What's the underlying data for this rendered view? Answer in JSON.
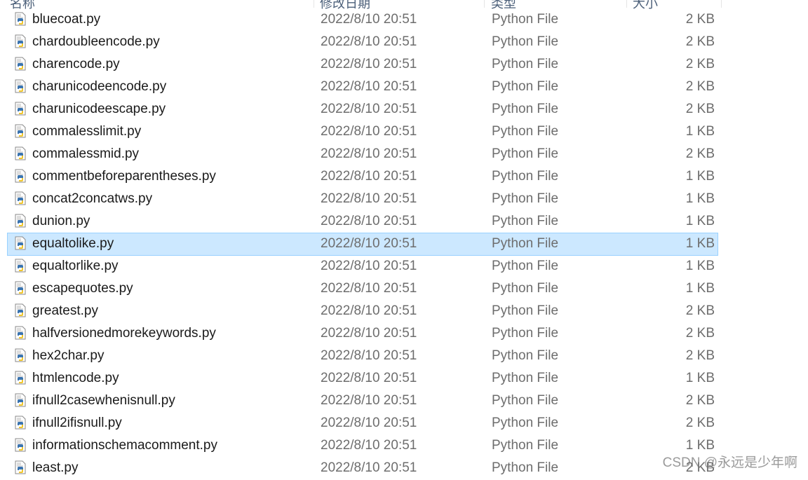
{
  "columns": {
    "name": "名称",
    "date": "修改日期",
    "type": "类型",
    "size": "大小"
  },
  "files": [
    {
      "name": "bluecoat.py",
      "date": "2022/8/10 20:51",
      "type": "Python File",
      "size": "2 KB"
    },
    {
      "name": "chardoubleencode.py",
      "date": "2022/8/10 20:51",
      "type": "Python File",
      "size": "2 KB"
    },
    {
      "name": "charencode.py",
      "date": "2022/8/10 20:51",
      "type": "Python File",
      "size": "2 KB"
    },
    {
      "name": "charunicodeencode.py",
      "date": "2022/8/10 20:51",
      "type": "Python File",
      "size": "2 KB"
    },
    {
      "name": "charunicodeescape.py",
      "date": "2022/8/10 20:51",
      "type": "Python File",
      "size": "2 KB"
    },
    {
      "name": "commalesslimit.py",
      "date": "2022/8/10 20:51",
      "type": "Python File",
      "size": "1 KB"
    },
    {
      "name": "commalessmid.py",
      "date": "2022/8/10 20:51",
      "type": "Python File",
      "size": "2 KB"
    },
    {
      "name": "commentbeforeparentheses.py",
      "date": "2022/8/10 20:51",
      "type": "Python File",
      "size": "1 KB"
    },
    {
      "name": "concat2concatws.py",
      "date": "2022/8/10 20:51",
      "type": "Python File",
      "size": "1 KB"
    },
    {
      "name": "dunion.py",
      "date": "2022/8/10 20:51",
      "type": "Python File",
      "size": "1 KB"
    },
    {
      "name": "equaltolike.py",
      "date": "2022/8/10 20:51",
      "type": "Python File",
      "size": "1 KB",
      "selected": true
    },
    {
      "name": "equaltorlike.py",
      "date": "2022/8/10 20:51",
      "type": "Python File",
      "size": "1 KB"
    },
    {
      "name": "escapequotes.py",
      "date": "2022/8/10 20:51",
      "type": "Python File",
      "size": "1 KB"
    },
    {
      "name": "greatest.py",
      "date": "2022/8/10 20:51",
      "type": "Python File",
      "size": "2 KB"
    },
    {
      "name": "halfversionedmorekeywords.py",
      "date": "2022/8/10 20:51",
      "type": "Python File",
      "size": "2 KB"
    },
    {
      "name": "hex2char.py",
      "date": "2022/8/10 20:51",
      "type": "Python File",
      "size": "2 KB"
    },
    {
      "name": "htmlencode.py",
      "date": "2022/8/10 20:51",
      "type": "Python File",
      "size": "1 KB"
    },
    {
      "name": "ifnull2casewhenisnull.py",
      "date": "2022/8/10 20:51",
      "type": "Python File",
      "size": "2 KB"
    },
    {
      "name": "ifnull2ifisnull.py",
      "date": "2022/8/10 20:51",
      "type": "Python File",
      "size": "2 KB"
    },
    {
      "name": "informationschemacomment.py",
      "date": "2022/8/10 20:51",
      "type": "Python File",
      "size": "1 KB"
    },
    {
      "name": "least.py",
      "date": "2022/8/10 20:51",
      "type": "Python File",
      "size": "2 KB"
    }
  ],
  "watermark": "CSDN @永远是少年啊",
  "colors": {
    "selected_bg": "#cce8ff",
    "selected_border": "#99d1ff"
  }
}
